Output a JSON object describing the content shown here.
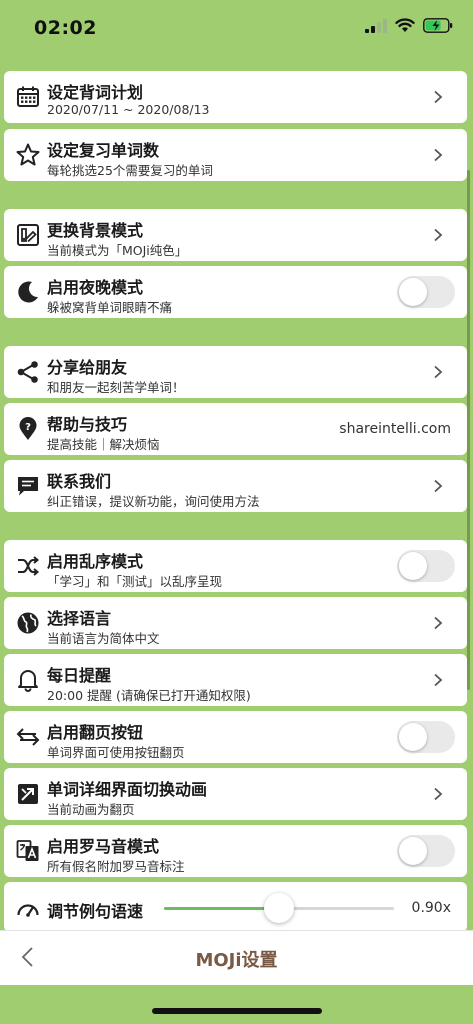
{
  "status": {
    "time": "02:02"
  },
  "cards": {
    "plan": {
      "title": "设定背词计划",
      "subtitle": "2020/07/11 ~ 2020/08/13"
    },
    "review": {
      "title": "设定复习单词数",
      "subtitle": "每轮挑选25个需要复习的单词"
    },
    "background": {
      "title": "更换背景模式",
      "subtitle": "当前模式为「MOJi纯色」"
    },
    "night": {
      "title": "启用夜晚模式",
      "subtitle": "躲被窝背单词眼睛不痛"
    },
    "share": {
      "title": "分享给朋友",
      "subtitle": "和朋友一起刻苦学单词！"
    },
    "help": {
      "title": "帮助与技巧",
      "subtitle": "提高技能｜解决烦恼",
      "link": "shareintelli.com"
    },
    "contact": {
      "title": "联系我们",
      "subtitle": "纠正错误，提议新功能，询问使用方法"
    },
    "shuffle": {
      "title": "启用乱序模式",
      "subtitle": "「学习」和「测试」以乱序呈现"
    },
    "language": {
      "title": "选择语言",
      "subtitle": "当前语言为简体中文"
    },
    "reminder": {
      "title": "每日提醒",
      "subtitle": "20:00 提醒 (请确保已打开通知权限)"
    },
    "flip": {
      "title": "启用翻页按钮",
      "subtitle": "单词界面可使用按钮翻页"
    },
    "animation": {
      "title": "单词详细界面切换动画",
      "subtitle": "当前动画为翻页"
    },
    "romaji": {
      "title": "启用罗马音模式",
      "subtitle": "所有假名附加罗马音标注"
    },
    "speed": {
      "title": "调节例句语速",
      "value_label": "0.90x",
      "value_fraction": 0.5
    }
  },
  "bottom_bar": {
    "title": "MOJi设置"
  },
  "colors": {
    "background": "#9fcd6f",
    "accent": "#6dbb5f",
    "title_brown": "#7a5a44"
  }
}
